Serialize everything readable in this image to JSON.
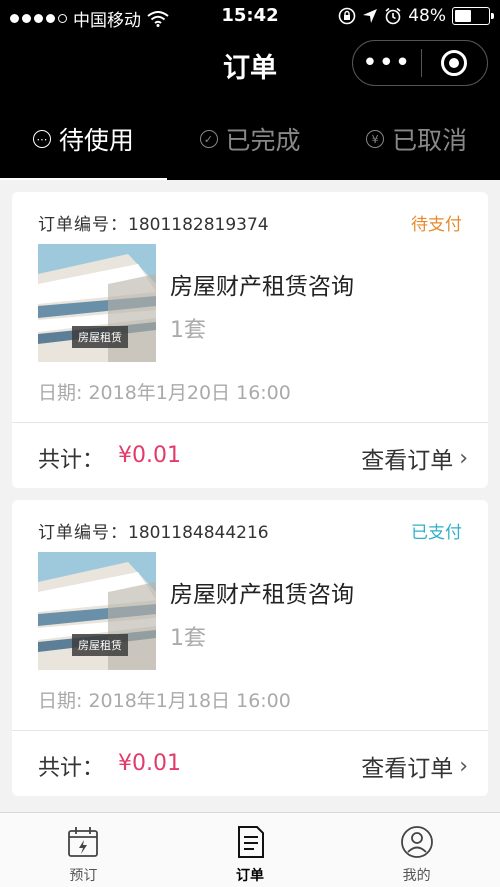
{
  "status_bar": {
    "carrier": "中国移动",
    "time": "15:42",
    "battery": "48%"
  },
  "nav": {
    "title": "订单",
    "more_label": "•••"
  },
  "tabs": [
    {
      "label": "待使用",
      "icon": "⋯"
    },
    {
      "label": "已完成",
      "icon": "✓"
    },
    {
      "label": "已取消",
      "icon": "¥"
    }
  ],
  "orders": [
    {
      "no_label": "订单编号：",
      "no": "1801182819374",
      "status": "待支付",
      "status_color": "#e8892b",
      "thumb_label": "房屋租赁",
      "product": "房屋财产租赁咨询",
      "qty": "1套",
      "date": "日期: 2018年1月20日 16:00",
      "total_label": "共计：",
      "total": "¥0.01",
      "view_label": "查看订单"
    },
    {
      "no_label": "订单编号：",
      "no": "1801184844216",
      "status": "已支付",
      "status_color": "#2fb0c7",
      "thumb_label": "房屋租赁",
      "product": "房屋财产租赁咨询",
      "qty": "1套",
      "date": "日期: 2018年1月18日 16:00",
      "total_label": "共计：",
      "total": "¥0.01",
      "view_label": "查看订单"
    }
  ],
  "tabbar": [
    {
      "label": "预订",
      "icon": "calendar-icon"
    },
    {
      "label": "订单",
      "icon": "document-icon"
    },
    {
      "label": "我的",
      "icon": "user-icon"
    }
  ]
}
